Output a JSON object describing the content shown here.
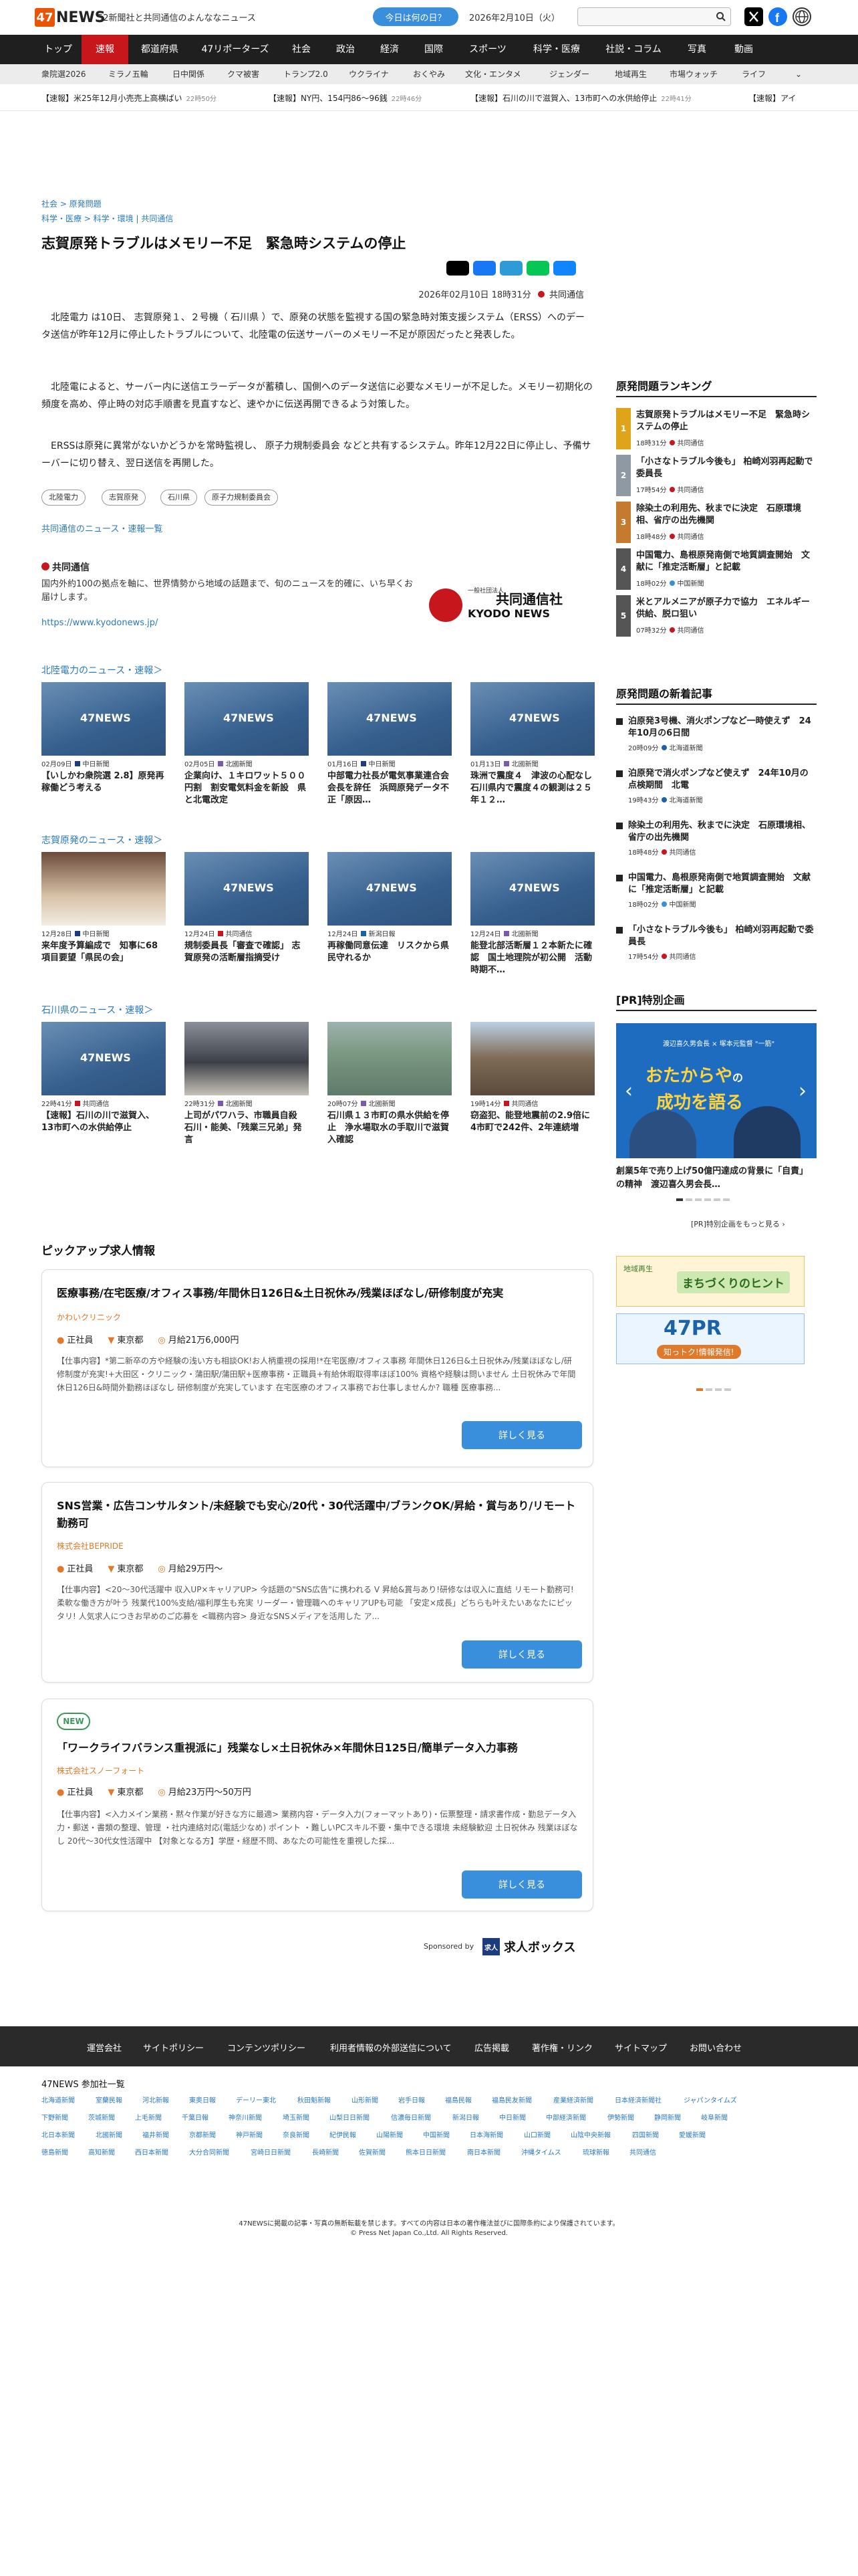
{
  "header": {
    "logo_num": "47",
    "logo_text": "NEWS",
    "tagline": "52新聞社と共同通信のよんななニュース",
    "today_label": "今日は何の日？",
    "date": "2026年2月10日（火）",
    "search_placeholder": ""
  },
  "nav": [
    "トップ",
    "速報",
    "都道府県",
    "47リポーターズ",
    "社会",
    "政治",
    "経済",
    "国際",
    "スポーツ",
    "科学・医療",
    "社説・コラム",
    "写真",
    "動画"
  ],
  "nav_active": 1,
  "subnav": [
    "衆院選2026",
    "ミラノ五輪",
    "日中関係",
    "クマ被害",
    "トランプ2.0",
    "ウクライナ",
    "おくやみ",
    "文化・エンタメ",
    "ジェンダー",
    "地域再生",
    "市場ウォッチ",
    "ライフ"
  ],
  "ticker": [
    {
      "text": "【速報】米25年12月小売売上高横ばい",
      "time": "22時50分"
    },
    {
      "text": "【速報】NY円、154円86〜96銭",
      "time": "22時46分"
    },
    {
      "text": "【速報】石川の川で滋賀入、13市町への水供給停止",
      "time": "22時41分"
    },
    {
      "text": "【速報】アイ",
      "time": ""
    }
  ],
  "article": {
    "breadcrumb1": "社会 > 原発問題",
    "breadcrumb2": "科学・医療 > 科学・環境 | 共同通信",
    "title": "志賀原発トラブルはメモリー不足　緊急時システムの停止",
    "datetime": "2026年02月10日 18時31分",
    "source": "共同通信",
    "paragraphs": [
      "北陸電力 は10日、 志賀原発１、２号機（ 石川県 ）で、原発の状態を監視する国の緊急時対策支援システム（ERSS）へのデータ送信が昨年12月に停止したトラブルについて、北陸電の伝送サーバーのメモリー不足が原因だったと発表した。",
      "北陸電によると、サーバー内に送信エラーデータが蓄積し、国側へのデータ送信に必要なメモリーが不足した。メモリー初期化の頻度を高め、停止時の対応手順書を見直すなど、速やかに伝送再開できるよう対策した。",
      "ERSSは原発に異常がないかどうかを常時監視し、 原子力規制委員会 などと共有するシステム。昨年12月22日に停止し、予備サーバーに切り替え、翌日送信を再開した。"
    ],
    "tags": [
      "北陸電力",
      "志賀原発",
      "石川県",
      "原子力規制委員会"
    ],
    "more_link": "共同通信のニュース・速報一覧"
  },
  "kyodo": {
    "name": "共同通信",
    "desc": "国内外約100の拠点を軸に、世界情勢から地域の話題まで、旬のニュースを的確に、いち早くお届けします。",
    "url": "https://www.kyodonews.jp/",
    "logo_small": "一般社団法人",
    "logo_main": "共同通信社",
    "logo_sub": "KYODO NEWS"
  },
  "sections": [
    {
      "title": "北陸電力のニュース・速報＞",
      "cards": [
        {
          "date": "02月09日",
          "src": "中日新聞",
          "title": "【いしかわ衆院選 2.8】原発再稼働どう考える"
        },
        {
          "date": "02月05日",
          "src": "北國新聞",
          "title": "企業向け、１キロワット５００円割　割安電気料金を新設　県と北電改定"
        },
        {
          "date": "01月16日",
          "src": "中日新聞",
          "title": "中部電力社長が電気事業連合会会長を辞任　浜岡原発データ不正「原因…"
        },
        {
          "date": "01月13日",
          "src": "北國新聞",
          "title": "珠洲で震度４　津波の心配なし　石川県内で震度４の観測は２５年１２…"
        }
      ]
    },
    {
      "title": "志賀原発のニュース・速報＞",
      "cards": [
        {
          "date": "12月28日",
          "src": "中日新聞",
          "title": "来年度予算編成で　知事に68項目要望「県民の会」"
        },
        {
          "date": "12月24日",
          "src": "共同通信",
          "title": "規制委員長「審査で確認」 志賀原発の活断層指摘受け"
        },
        {
          "date": "12月24日",
          "src": "新潟日報",
          "title": "再稼働同意伝達　リスクから県民守れるか"
        },
        {
          "date": "12月24日",
          "src": "北國新聞",
          "title": "能登北部活断層１２本新たに確認　国土地理院が初公開　活動時期不…"
        }
      ]
    },
    {
      "title": "石川県のニュース・速報＞",
      "cards": [
        {
          "date": "22時41分",
          "src": "共同通信",
          "title": "【速報】石川の川で滋賀入、13市町への水供給停止"
        },
        {
          "date": "22時31分",
          "src": "北國新聞",
          "title": "上司がパワハラ、市職員自殺　石川・能美、「残業三兄弟」発言"
        },
        {
          "date": "20時07分",
          "src": "北國新聞",
          "title": "石川県１３市町の県水供給を停止　浄水場取水の手取川で滋賀入確認"
        },
        {
          "date": "19時14分",
          "src": "共同通信",
          "title": "窃盗犯、能登地震前の2.9倍に　4市町で242件、2年連続増"
        }
      ]
    }
  ],
  "jobs": {
    "heading": "ピックアップ求人情報",
    "items": [
      {
        "new": "",
        "title": "医療事務/在宅医療/オフィス事務/年間休日126日&土日祝休み/残業ほぼなし/研修制度が充実",
        "company": "かわいクリニック",
        "type": "正社員",
        "location": "東京都",
        "salary": "月給21万6,000円",
        "desc": "【仕事内容】*第二新卒の方や経験の浅い方も相談OK!お人柄重視の採用!*在宅医療/オフィス事務 年間休日126日&土日祝休み/残業ほぼなし/研修制度が充実!+大田区・クリニック・蒲田駅/蒲田駅+医療事務・正職員+有給休暇取得率ほぼ100% 資格や経験は問いません 土日祝休みで年間休日126日&時間外勤務ほぼなし 研修制度が充実しています 在宅医療のオフィス事務でお仕事しませんか? 職種 医療事務...",
        "button": "詳しく見る"
      },
      {
        "new": "",
        "title": "SNS営業・広告コンサルタント/未経験でも安心/20代・30代活躍中/ブランクOK/昇給・賞与あり/リモート勤務可",
        "company": "株式会社BEPRIDE",
        "type": "正社員",
        "location": "東京都",
        "salary": "月給29万円〜",
        "desc": "【仕事内容】<20〜30代活躍中 収入UP×キャリアUP> 今話題の\"SNS広告\"に携われる V 昇給&賞与あり!研修なは収入に直結 リモート勤務可!柔軟な働き方が叶う 残業代100%支給/福利厚生も充実 リーダー・管理職へのキャリアUPも可能 「安定×成長」どちらも叶えたいあなたにピッタリ! 人気求人につきお早めのご応募を <職務内容> 身近なSNSメディアを活用した ア...",
        "button": "詳しく見る"
      },
      {
        "new": "NEW",
        "title": "「ワークライフバランス重視派に」残業なし×土日祝休み×年間休日125日/簡単データ入力事務",
        "company": "株式会社スノーフォート",
        "type": "正社員",
        "location": "東京都",
        "salary": "月給23万円〜50万円",
        "desc": "【仕事内容】<入力メイン業務・黙々作業が好きな方に最適> 業務内容・データ入力(フォーマットあり)・伝票整理・請求書作成・勤怠データ入力・郵送・書類の整理、管理 ・社内連絡対応(電話少なめ) ポイント ・難しいPCスキル不要・集中できる環境 未経験歓迎 土日祝休み 残業ほぼなし 20代〜30代女性活躍中 【対象となる方】学歴・経歴不問、あなたの可能性を重視した採...",
        "button": "詳しく見る"
      }
    ],
    "sponsored_by": "Sponsored by",
    "sponsor_name": "求人ボックス",
    "sponsor_mark": "求人"
  },
  "sidebar": {
    "ranking_title": "原発問題ランキング",
    "ranking": [
      {
        "num": "1",
        "title": "志賀原発トラブルはメモリー不足　緊急時システムの停止",
        "time": "18時31分",
        "src": "共同通信"
      },
      {
        "num": "2",
        "title": "「小さなトラブル今後も」 柏崎刈羽再起動で委員長",
        "time": "17時54分",
        "src": "共同通信"
      },
      {
        "num": "3",
        "title": "除染土の利用先、秋までに決定　石原環境相、省庁の出先機関",
        "time": "18時48分",
        "src": "共同通信"
      },
      {
        "num": "4",
        "title": "中国電力、島根原発南側で地質調査開始　文献に「推定活断層」と記載",
        "time": "18時02分",
        "src": "中国新聞"
      },
      {
        "num": "5",
        "title": "米とアルメニアが原子力で協力　エネルギー供給、脱ロ狙い",
        "time": "07時32分",
        "src": "共同通信"
      }
    ],
    "latest_title": "原発問題の新着記事",
    "latest": [
      {
        "title": "泊原発3号機、消火ポンプなど一時使えず　24年10月の6日間",
        "time": "20時09分",
        "src": "北海道新聞"
      },
      {
        "title": "泊原発で消火ポンプなど使えず　24年10月の点検期間　北電",
        "time": "19時43分",
        "src": "北海道新聞"
      },
      {
        "title": "除染土の利用先、秋までに決定　石原環境相、省庁の出先機関",
        "time": "18時48分",
        "src": "共同通信"
      },
      {
        "title": "中国電力、島根原発南側で地質調査開始　文献に「推定活断層」と記載",
        "time": "18時02分",
        "src": "中国新聞"
      },
      {
        "title": "「小さなトラブル今後も」 柏崎刈羽再起動で委員長",
        "time": "17時54分",
        "src": "共同通信"
      }
    ],
    "pr_title": "[PR]特別企画",
    "pr_banner_small": "渡辺喜久男会長 × 塚本元監督 \"一筋\"",
    "pr_banner_main": "おたからや",
    "pr_banner_main2": "の",
    "pr_banner_main3": "成功を語る",
    "pr_caption": "創業5年で売り上げ50億円達成の背景に「自責」の精神　渡辺喜久男会長…",
    "pr_more": "[PR]特別企画をもっと見る ›",
    "ad1_title": "まちづくりのヒント",
    "ad1_sub": "地域再生",
    "ad2_title": "47PR",
    "ad2_sub": "知っトク!情報発信!"
  },
  "footer": {
    "links": [
      "運営会社",
      "サイトポリシー",
      "コンテンツポリシー",
      "利用者情報の外部送信について",
      "広告掲載",
      "著作権・リンク",
      "サイトマップ",
      "お問い合わせ"
    ],
    "partners_title": "47NEWS 参加社一覧",
    "partners": [
      [
        "北海道新聞",
        "室蘭民報",
        "河北新報",
        "東奥日報",
        "デーリー東北",
        "秋田魁新報",
        "山形新聞",
        "岩手日報",
        "福島民報",
        "福島民友新聞",
        "産業経済新聞",
        "日本経済新聞社",
        "ジャパンタイムズ"
      ],
      [
        "下野新聞",
        "茨城新聞",
        "上毛新聞",
        "千葉日報",
        "神奈川新聞",
        "埼玉新聞",
        "山梨日日新聞",
        "信濃毎日新聞",
        "新潟日報",
        "中日新聞",
        "中部経済新聞",
        "伊勢新聞",
        "静岡新聞",
        "岐阜新聞"
      ],
      [
        "北日本新聞",
        "北國新聞",
        "福井新聞",
        "京都新聞",
        "神戸新聞",
        "奈良新聞",
        "紀伊民報",
        "山陽新聞",
        "中国新聞",
        "日本海新聞",
        "山口新聞",
        "山陰中央新報",
        "四国新聞",
        "愛媛新聞"
      ],
      [
        "徳島新聞",
        "高知新聞",
        "西日本新聞",
        "大分合同新聞",
        "宮崎日日新聞",
        "長崎新聞",
        "佐賀新聞",
        "熊本日日新聞",
        "南日本新聞",
        "沖縄タイムス",
        "琉球新報",
        "共同通信"
      ]
    ],
    "legal1": "47NEWSに掲載の記事・写真の無断転載を禁じます。すべての内容は日本の著作権法並びに国際条約により保護されています。",
    "legal2": "© Press Net Japan Co.,Ltd. All Rights Reserved."
  },
  "colors": {
    "brand_orange": "#e95504",
    "nav_active": "#c8161d",
    "link_blue": "#2a7ac0",
    "button_blue": "#3a8fdc",
    "kyodo_red": "#c8161d",
    "hokkoku": "#1c3c7e"
  }
}
